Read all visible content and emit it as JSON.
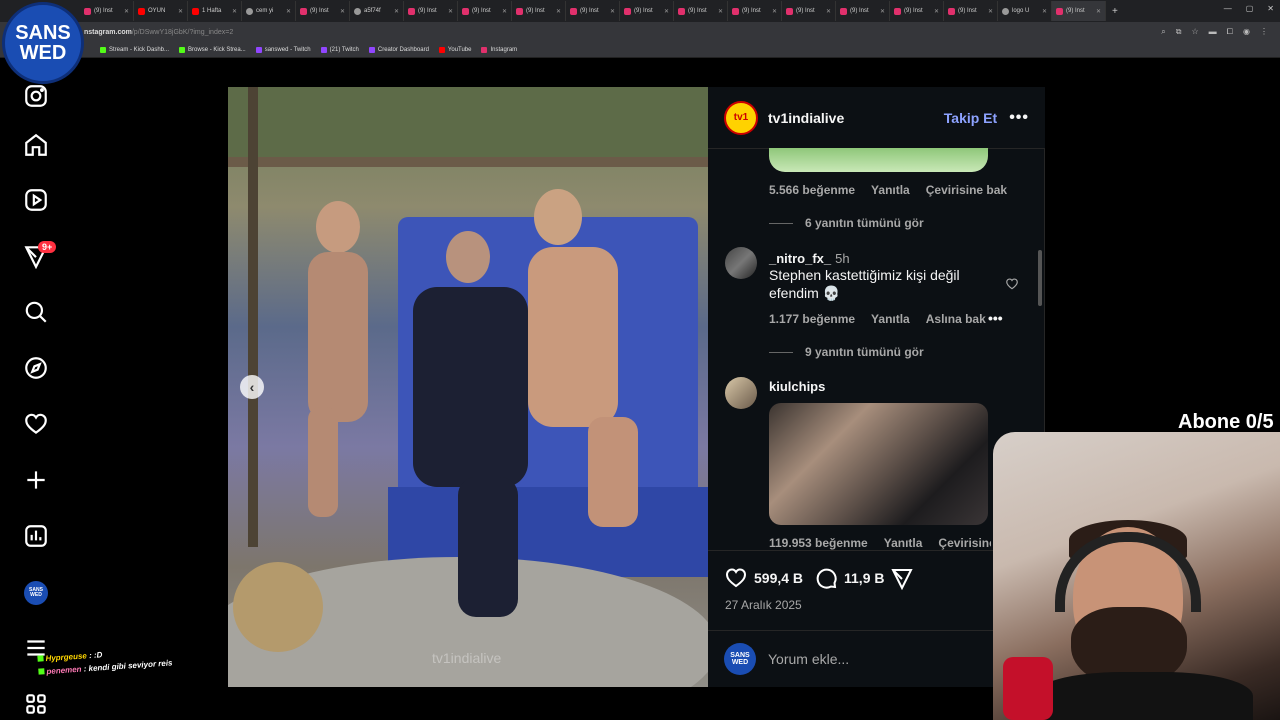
{
  "browser": {
    "tabs": [
      {
        "label": "(9) Inst",
        "icon": "instagram"
      },
      {
        "label": "OYUN",
        "icon": "youtube"
      },
      {
        "label": "1 Hafta",
        "icon": "youtube"
      },
      {
        "label": "cem yi",
        "icon": "generic"
      },
      {
        "label": "(9) Inst",
        "icon": "instagram"
      },
      {
        "label": "a5f74f",
        "icon": "generic"
      },
      {
        "label": "(9) Inst",
        "icon": "instagram"
      },
      {
        "label": "(9) Inst",
        "icon": "instagram"
      },
      {
        "label": "(9) Inst",
        "icon": "instagram"
      },
      {
        "label": "(9) Inst",
        "icon": "instagram"
      },
      {
        "label": "(9) Inst",
        "icon": "instagram"
      },
      {
        "label": "(9) Inst",
        "icon": "instagram"
      },
      {
        "label": "(9) Inst",
        "icon": "instagram"
      },
      {
        "label": "(9) Inst",
        "icon": "instagram"
      },
      {
        "label": "(9) Inst",
        "icon": "instagram"
      },
      {
        "label": "(9) Inst",
        "icon": "instagram"
      },
      {
        "label": "(9) Inst",
        "icon": "instagram"
      },
      {
        "label": "logo U",
        "icon": "generic"
      },
      {
        "label": "(9) Inst",
        "icon": "instagram"
      }
    ],
    "url_host": "nstagram.com",
    "url_path": "/p/DSwwY18jGbK/?img_index=2",
    "bookmarks": [
      {
        "label": "Stream - Kick Dashb...",
        "icon": "kick"
      },
      {
        "label": "Browse - Kick Strea...",
        "icon": "kick"
      },
      {
        "label": "sanswed - Twitch",
        "icon": "twitch"
      },
      {
        "label": "(21) Twitch",
        "icon": "twitch"
      },
      {
        "label": "Creator Dashboard",
        "icon": "twitch"
      },
      {
        "label": "YouTube",
        "icon": "youtube"
      },
      {
        "label": "Instagram",
        "icon": "instagram"
      }
    ]
  },
  "stream_logo": {
    "line1": "SANS",
    "line2": "WED"
  },
  "nav": {
    "notif_count": "9+",
    "avatar_text": "SANS WED"
  },
  "chat": {
    "line1_user": "Hyprgeuse",
    "line1_msg": " : :D",
    "line2_user": "penemen",
    "line2_msg": " : kendi gibi seviyor reis"
  },
  "post": {
    "watermark": "tv1indialive",
    "username": "tv1indialive",
    "avatar_text": "tv1",
    "follow_label": "Takip Et",
    "more_label": "•••",
    "comment0": {
      "likes": "5.566 beğenme",
      "reply": "Yanıtla",
      "translate": "Çevirisine bak",
      "view_replies": "6 yanıtın tümünü gör"
    },
    "comment1": {
      "user": "_nitro_fx_",
      "time": "5h",
      "text": "Stephen kastettiğimiz kişi değil efendim 💀",
      "likes": "1.177 beğenme",
      "reply": "Yanıtla",
      "translate": "Aslına bak",
      "view_replies": "9 yanıtın tümünü gör"
    },
    "comment2": {
      "user": "kiulchips",
      "likes": "119.953 beğenme",
      "reply": "Yanıtla",
      "translate": "Çevirisine bak"
    },
    "like_count": "599,4 B",
    "comment_count": "11,9 B",
    "date": "27 Aralık 2025",
    "input_placeholder": "Yorum ekle...",
    "input_avatar_text": "SANS WED"
  },
  "overlay": {
    "sub_goal": "Abone 0/5"
  },
  "colors": {
    "accent": "#8da2ff",
    "badge": "#ff3040",
    "panel_bg": "#0c1014"
  }
}
